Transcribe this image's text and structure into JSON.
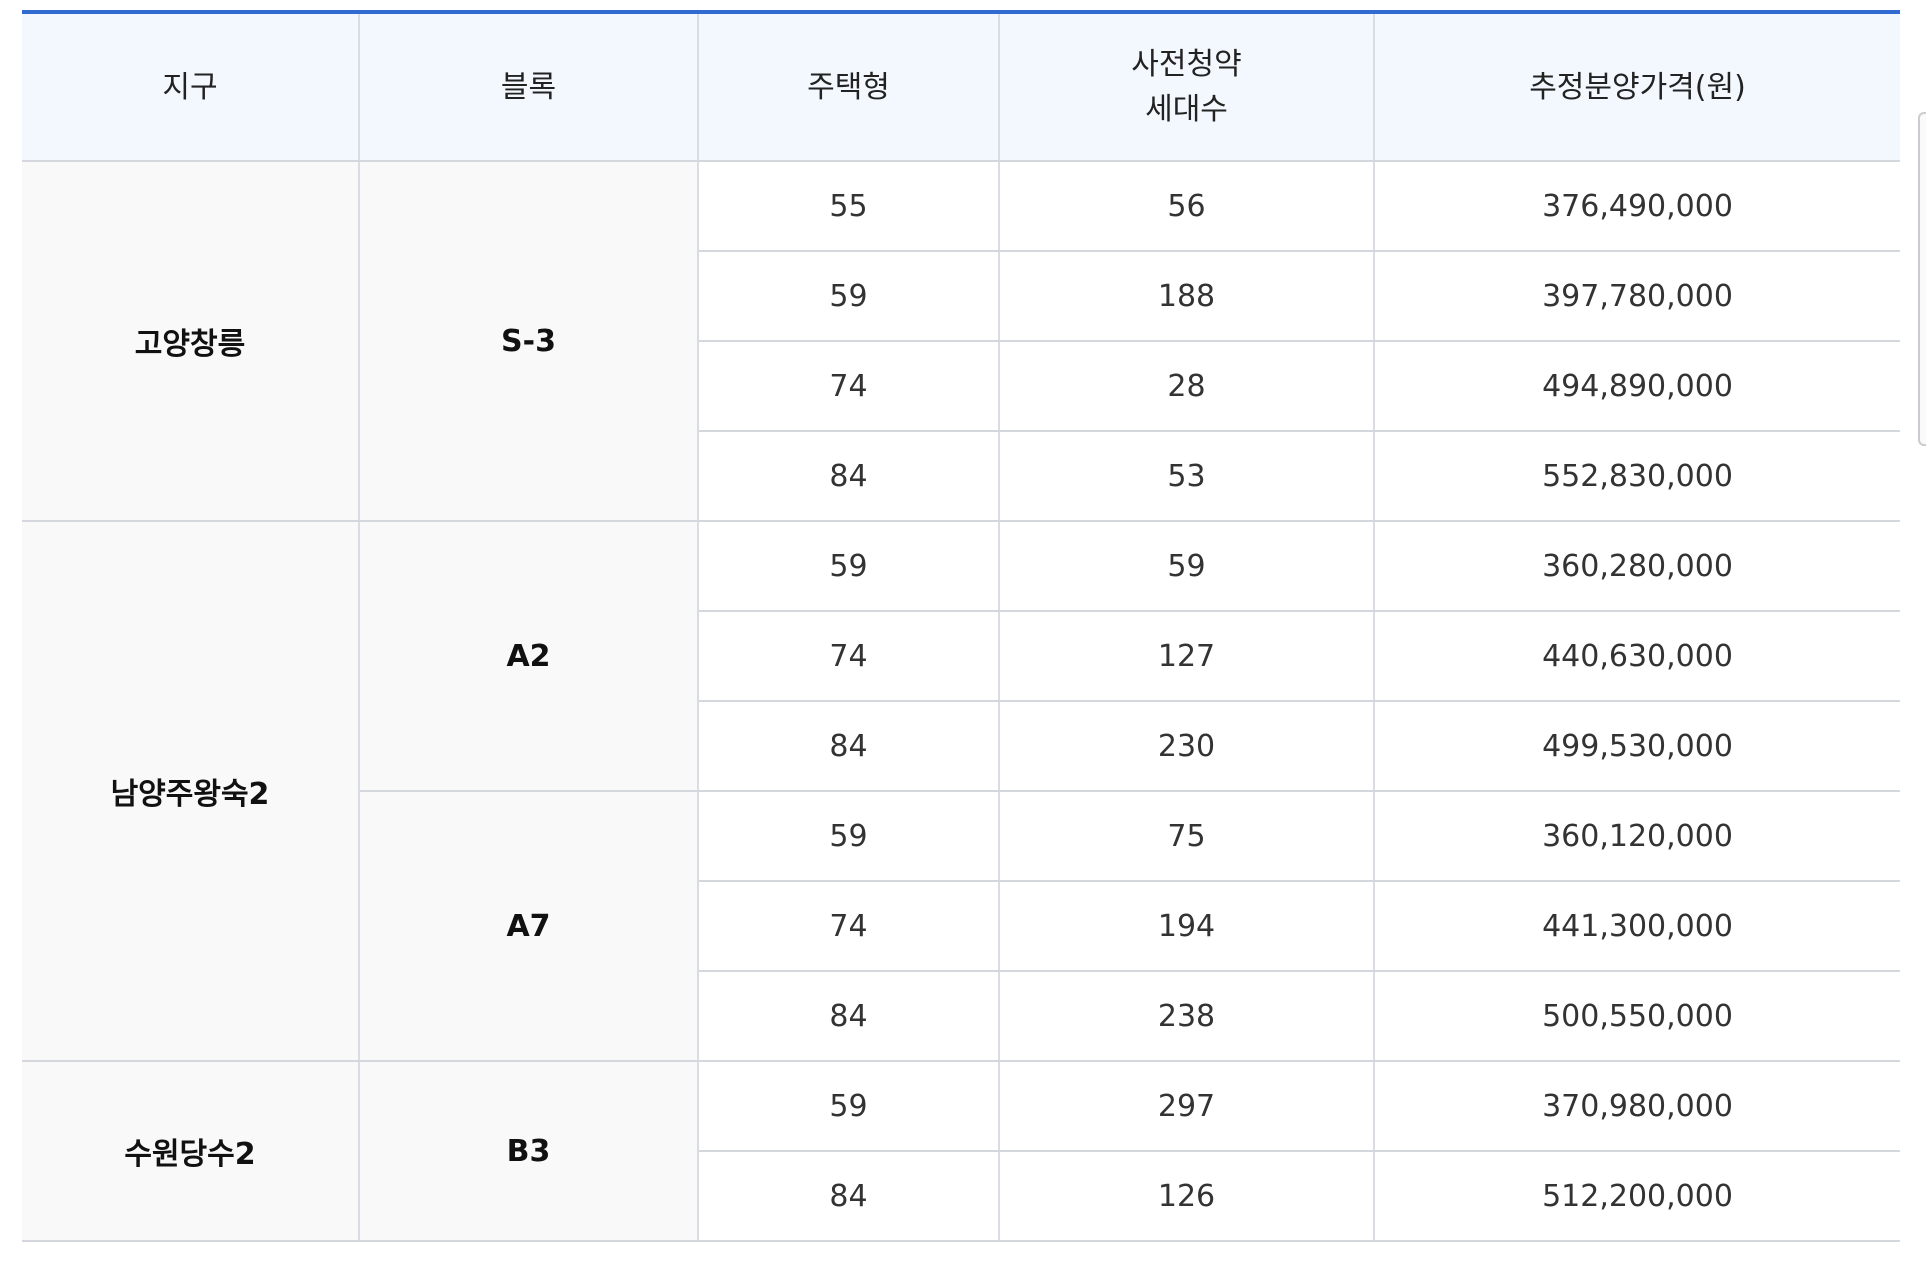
{
  "headers": {
    "district": "지구",
    "block": "블록",
    "house_type": "주택형",
    "households_line1": "사전청약",
    "households_line2": "세대수",
    "price": "추정분양가격(원)"
  },
  "districts": [
    {
      "name": "고양창릉",
      "blocks": [
        {
          "name": "S-3",
          "rows": [
            {
              "type": "55",
              "households": "56",
              "price": "376,490,000"
            },
            {
              "type": "59",
              "households": "188",
              "price": "397,780,000"
            },
            {
              "type": "74",
              "households": "28",
              "price": "494,890,000"
            },
            {
              "type": "84",
              "households": "53",
              "price": "552,830,000"
            }
          ]
        }
      ]
    },
    {
      "name": "남양주왕숙2",
      "blocks": [
        {
          "name": "A2",
          "rows": [
            {
              "type": "59",
              "households": "59",
              "price": "360,280,000"
            },
            {
              "type": "74",
              "households": "127",
              "price": "440,630,000"
            },
            {
              "type": "84",
              "households": "230",
              "price": "499,530,000"
            }
          ]
        },
        {
          "name": "A7",
          "rows": [
            {
              "type": "59",
              "households": "75",
              "price": "360,120,000"
            },
            {
              "type": "74",
              "households": "194",
              "price": "441,300,000"
            },
            {
              "type": "84",
              "households": "238",
              "price": "500,550,000"
            }
          ]
        }
      ]
    },
    {
      "name": "수원당수2",
      "blocks": [
        {
          "name": "B3",
          "rows": [
            {
              "type": "59",
              "households": "297",
              "price": "370,980,000"
            },
            {
              "type": "84",
              "households": "126",
              "price": "512,200,000"
            }
          ]
        }
      ]
    }
  ]
}
